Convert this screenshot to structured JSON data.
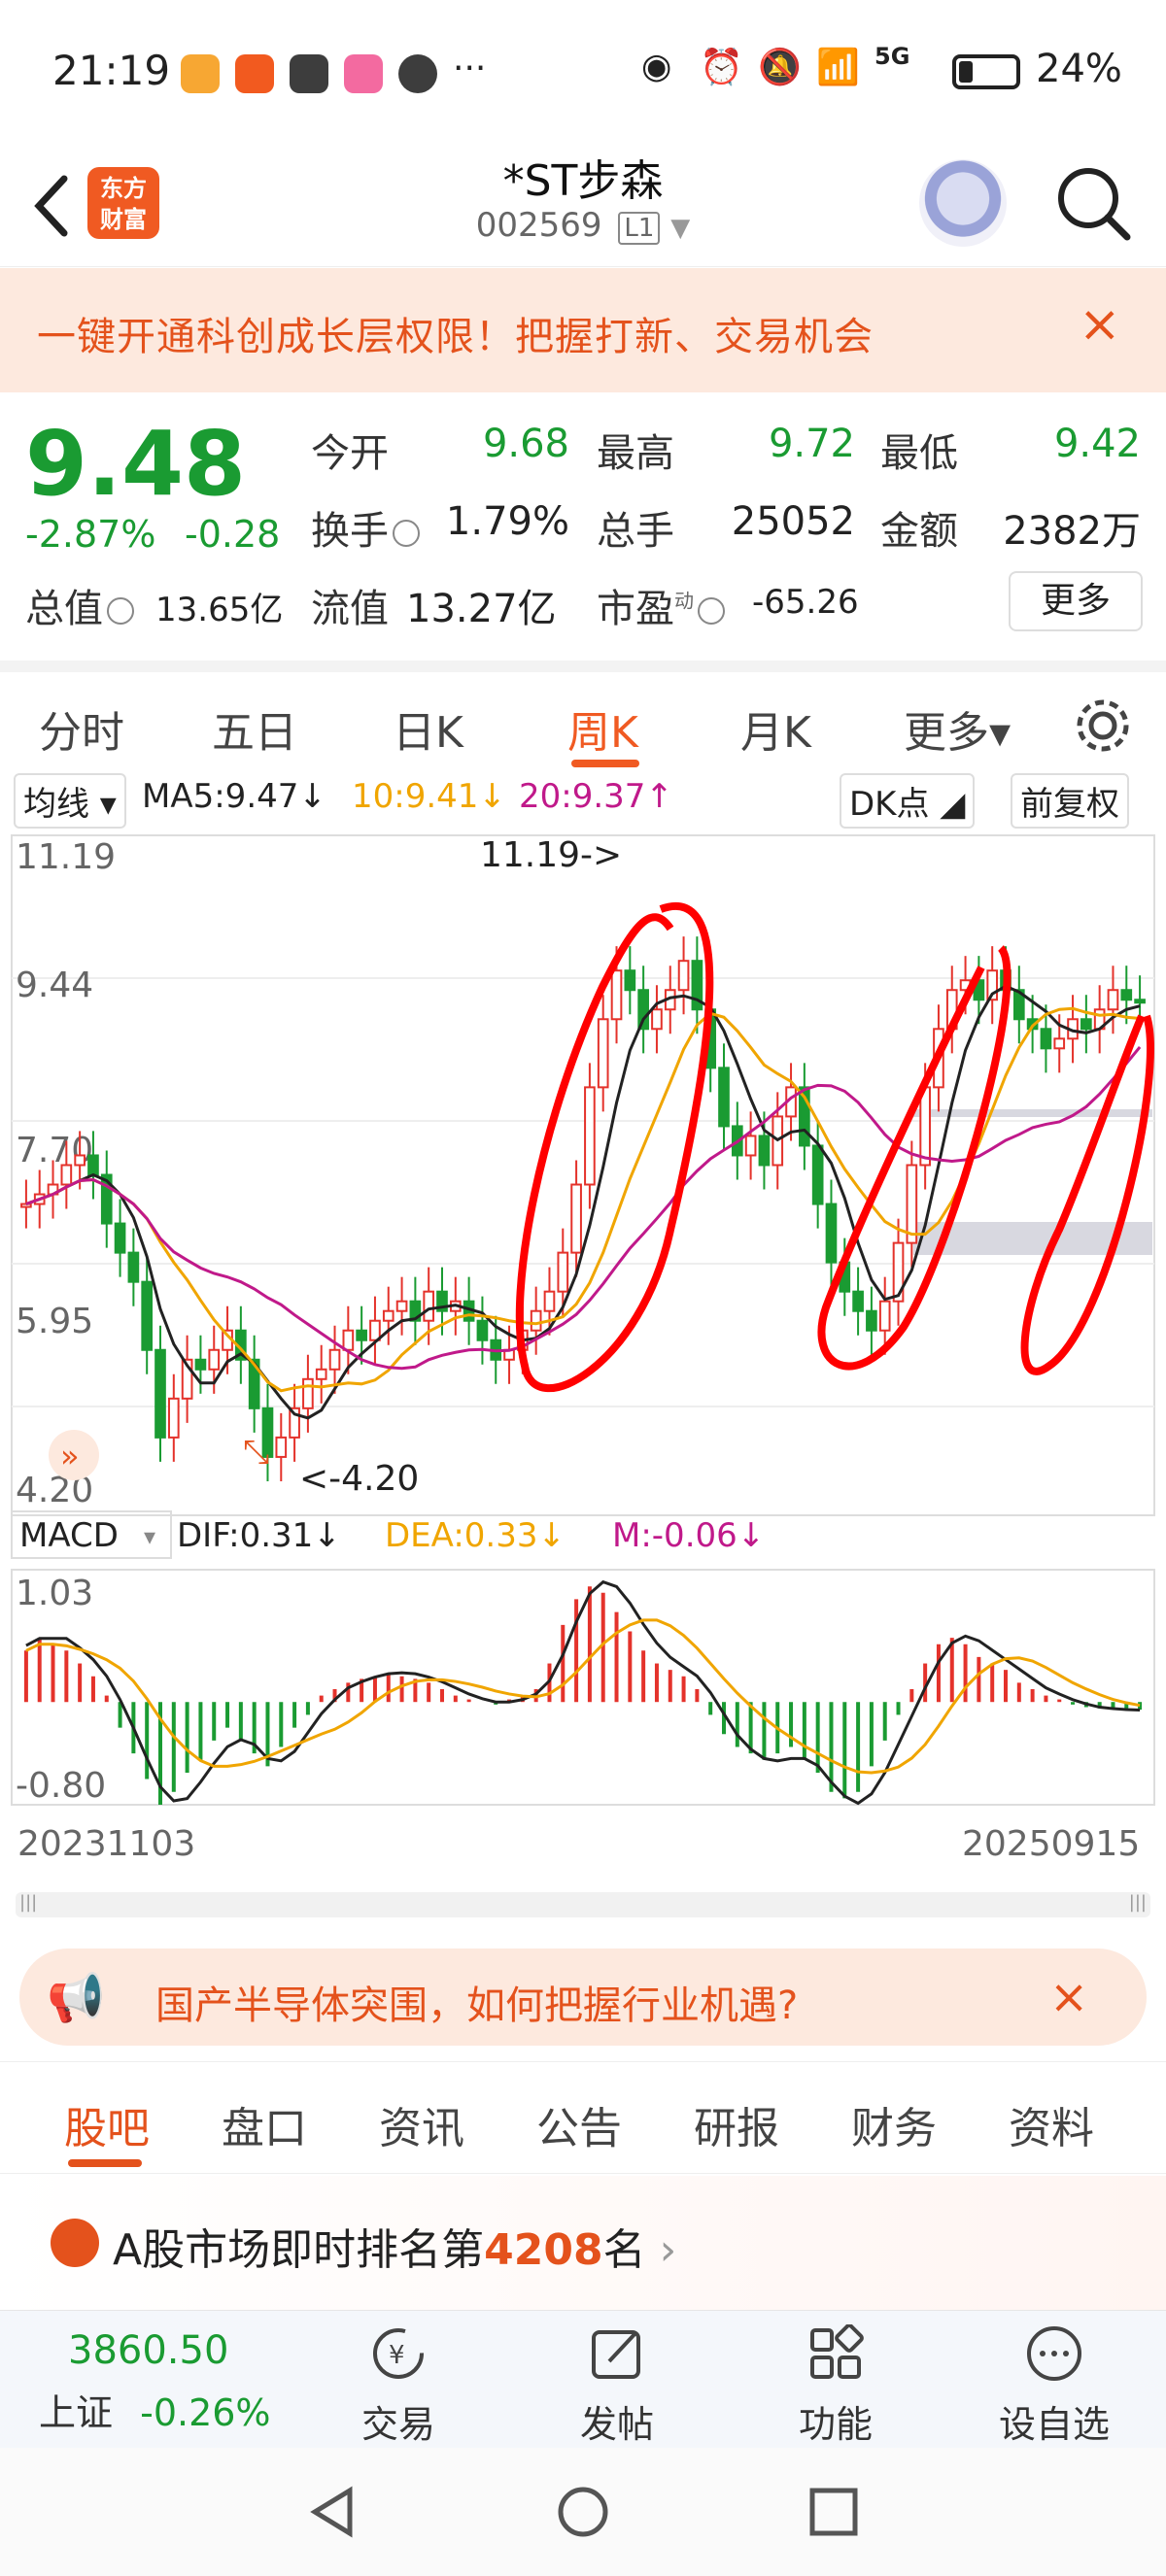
{
  "status_bar": {
    "time": "21:19",
    "battery": "24%",
    "network": "5G"
  },
  "header": {
    "stock_name": "*ST步森",
    "stock_code": "002569",
    "code_badge": "L1",
    "logo_line1": "东方",
    "logo_line2": "财富"
  },
  "promo": {
    "text": "一键开通科创成长层权限！把握打新、交易机会",
    "close": "×"
  },
  "quote": {
    "price": "9.48",
    "change_pct": "-2.87%",
    "change": "-0.28",
    "open_label": "今开",
    "open": "9.68",
    "high_label": "最高",
    "high": "9.72",
    "low_label": "最低",
    "low": "9.42",
    "turnover_label": "换手",
    "turnover": "1.79%",
    "volume_label": "总手",
    "volume": "25052",
    "amount_label": "金额",
    "amount": "2382万",
    "mktcap_label": "总值",
    "mktcap": "13.65亿",
    "float_label": "流值",
    "float": "13.27亿",
    "pe_label": "市盈",
    "pe_sup": "动",
    "pe": "-65.26",
    "more": "更多"
  },
  "kline_tabs": [
    "分时",
    "五日",
    "日K",
    "周K",
    "月K",
    "更多▾"
  ],
  "ma_row": {
    "ma_btn": "均线",
    "ma5": "MA5:9.47↓",
    "ma10": "10:9.41↓",
    "ma20": "20:9.37↑",
    "dk": "DK点",
    "adjust": "前复权",
    "ma5_color": "#222222",
    "ma10_color": "#f0a500",
    "ma20_color": "#c0198a"
  },
  "chart_data": {
    "type": "candlestick",
    "y_ticks": [
      "11.19",
      "9.44",
      "7.70",
      "5.95",
      "4.20"
    ],
    "ylim": [
      4.2,
      11.19
    ],
    "high_marker": "11.19->",
    "low_marker": "<-4.20",
    "x_start": "20231103",
    "x_end": "20250915",
    "macd": {
      "label": "MACD",
      "dif": "DIF:0.31↓",
      "dea": "DEA:0.33↓",
      "m": "M:-0.06↓",
      "y_ticks": [
        "1.03",
        "-0.80"
      ],
      "ylim": [
        -0.8,
        1.03
      ]
    },
    "close_series": [
      7.4,
      7.5,
      7.6,
      7.8,
      7.9,
      7.7,
      7.2,
      6.9,
      6.6,
      5.9,
      5.0,
      5.4,
      5.8,
      5.7,
      5.9,
      6.1,
      5.8,
      5.3,
      4.8,
      5.0,
      5.3,
      5.6,
      5.7,
      5.9,
      6.1,
      6.0,
      6.2,
      6.3,
      6.4,
      6.2,
      6.5,
      6.3,
      6.4,
      6.2,
      6.0,
      5.8,
      5.9,
      6.1,
      6.3,
      6.5,
      6.9,
      7.6,
      8.6,
      9.3,
      9.8,
      9.6,
      9.2,
      9.4,
      9.6,
      9.9,
      9.4,
      8.8,
      8.2,
      7.9,
      8.1,
      7.8,
      8.3,
      8.6,
      8.0,
      7.4,
      6.8,
      6.5,
      6.3,
      6.1,
      6.4,
      7.0,
      7.8,
      8.6,
      9.2,
      9.6,
      9.7,
      9.5,
      9.8,
      9.6,
      9.3,
      9.2,
      9.0,
      9.1,
      9.3,
      9.2,
      9.4,
      9.6,
      9.5,
      9.48
    ],
    "macd_bars": [
      0.4,
      0.5,
      0.45,
      0.4,
      0.3,
      0.2,
      0.05,
      -0.2,
      -0.4,
      -0.6,
      -0.8,
      -0.7,
      -0.55,
      -0.45,
      -0.3,
      -0.2,
      -0.3,
      -0.4,
      -0.5,
      -0.35,
      -0.2,
      -0.1,
      0.05,
      0.1,
      0.15,
      0.18,
      0.2,
      0.22,
      0.2,
      0.18,
      0.15,
      0.1,
      0.05,
      0.02,
      0.0,
      -0.02,
      0.02,
      0.05,
      0.1,
      0.3,
      0.6,
      0.8,
      0.9,
      0.85,
      0.7,
      0.55,
      0.4,
      0.3,
      0.25,
      0.2,
      0.1,
      -0.1,
      -0.25,
      -0.35,
      -0.4,
      -0.45,
      -0.4,
      -0.35,
      -0.45,
      -0.55,
      -0.7,
      -0.75,
      -0.7,
      -0.5,
      -0.3,
      -0.1,
      0.1,
      0.3,
      0.45,
      0.5,
      0.45,
      0.35,
      0.3,
      0.25,
      0.15,
      0.1,
      0.05,
      0.02,
      -0.02,
      -0.04,
      -0.05,
      -0.05,
      -0.06,
      -0.06
    ]
  },
  "banner2": {
    "text": "国产半导体突围，如何把握行业机遇?",
    "close": "×"
  },
  "bottom_tabs": [
    "股吧",
    "盘口",
    "资讯",
    "公告",
    "研报",
    "财务",
    "资料"
  ],
  "rank": {
    "prefix": "A股市场即时排名第",
    "number": "4208",
    "suffix": "名"
  },
  "toolbar": {
    "index_value": "3860.50",
    "index_name": "上证",
    "index_change": "-0.26%",
    "trade": "交易",
    "post": "发帖",
    "func": "功能",
    "watch": "设自选"
  }
}
